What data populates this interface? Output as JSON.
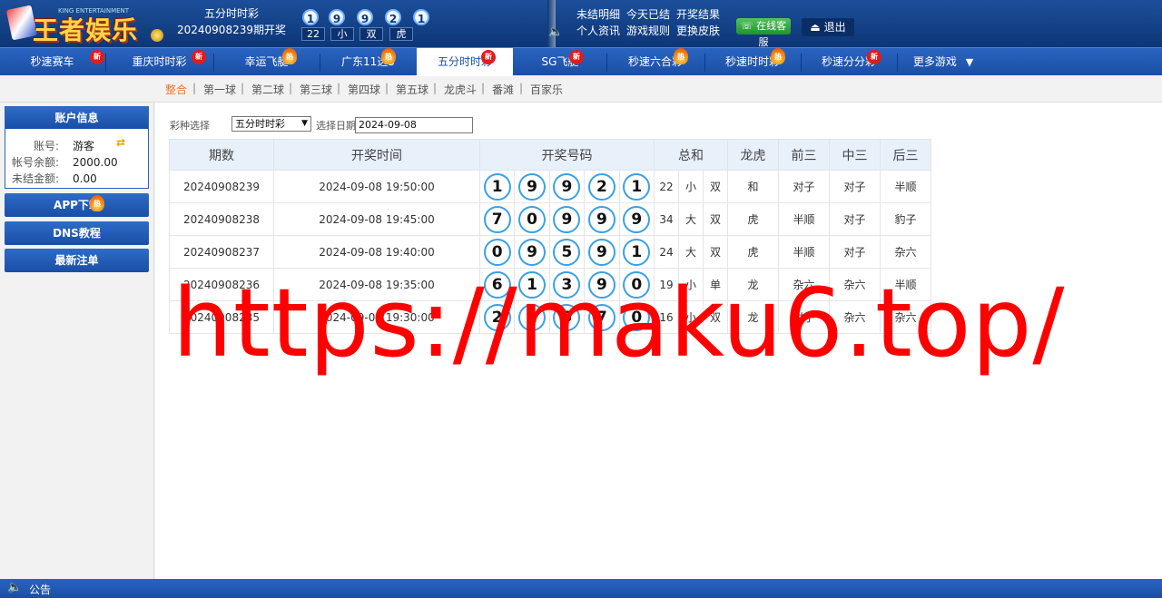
{
  "header": {
    "logo_text": "王者娱乐",
    "logo_sub": "KING ENTERTAINMENT",
    "current_game": "五分时时彩",
    "current_issue": "20240908239期开奖",
    "balls": [
      "1",
      "9",
      "9",
      "2",
      "1"
    ],
    "stats": [
      "22",
      "小",
      "双",
      "虎"
    ],
    "links_row1": [
      "未结明细",
      "今天已结",
      "开奖结果"
    ],
    "links_row2": [
      "个人资讯",
      "游戏规则",
      "更换皮肤"
    ],
    "service": "在线客服",
    "logout": "退出"
  },
  "nav": {
    "items": [
      {
        "label": "秒速赛车",
        "badge": "新"
      },
      {
        "label": "重庆时时彩",
        "badge": "新"
      },
      {
        "label": "幸运飞艇",
        "badge": "热"
      },
      {
        "label": "广东11选5",
        "badge": "热"
      },
      {
        "label": "五分时时彩",
        "badge": "新"
      },
      {
        "label": "SG飞艇",
        "badge": "新"
      },
      {
        "label": "秒速六合彩",
        "badge": "热"
      },
      {
        "label": "秒速时时彩",
        "badge": "热"
      },
      {
        "label": "秒速分分彩",
        "badge": "新"
      },
      {
        "label": "更多游戏",
        "badge": ""
      }
    ],
    "more_arrow": "▼"
  },
  "subnav": {
    "items": [
      "整合",
      "第一球",
      "第二球",
      "第三球",
      "第四球",
      "第五球",
      "龙虎斗",
      "番滩",
      "百家乐"
    ],
    "separator": "|"
  },
  "sidebar": {
    "account_title": "账户信息",
    "account_label": "账号:",
    "account_value": "游客",
    "balance_label": "帐号余额:",
    "balance_value": "2000.00",
    "unsettled_label": "未结金额:",
    "unsettled_value": "0.00",
    "app_download": "APP下载",
    "app_badge": "热",
    "dns_tutorial": "DNS教程",
    "latest_bets": "最新注单"
  },
  "filter": {
    "game_label": "彩种选择",
    "game_value": "五分时时彩",
    "date_label": "选择日期",
    "date_value": "2024-09-08"
  },
  "table": {
    "headers": {
      "issue": "期数",
      "time": "开奖时间",
      "numbers": "开奖号码",
      "sum": "总和",
      "dragon_tiger": "龙虎",
      "front3": "前三",
      "mid3": "中三",
      "back3": "后三"
    },
    "rows": [
      {
        "issue": "20240908239",
        "time": "2024-09-08 19:50:00",
        "balls": [
          "1",
          "9",
          "9",
          "2",
          "1"
        ],
        "sum": "22",
        "size": "小",
        "parity": "双",
        "dt": "和",
        "front": "对子",
        "mid": "对子",
        "back": "半顺"
      },
      {
        "issue": "20240908238",
        "time": "2024-09-08 19:45:00",
        "balls": [
          "7",
          "0",
          "9",
          "9",
          "9"
        ],
        "sum": "34",
        "size": "大",
        "parity": "双",
        "dt": "虎",
        "front": "半顺",
        "mid": "对子",
        "back": "豹子"
      },
      {
        "issue": "20240908237",
        "time": "2024-09-08 19:40:00",
        "balls": [
          "0",
          "9",
          "5",
          "9",
          "1"
        ],
        "sum": "24",
        "size": "大",
        "parity": "双",
        "dt": "虎",
        "front": "半顺",
        "mid": "对子",
        "back": "杂六"
      },
      {
        "issue": "20240908236",
        "time": "2024-09-08 19:35:00",
        "balls": [
          "6",
          "1",
          "3",
          "9",
          "0"
        ],
        "sum": "19",
        "size": "小",
        "parity": "单",
        "dt": "龙",
        "front": "杂六",
        "mid": "杂六",
        "back": "半顺"
      },
      {
        "issue": "20240908235",
        "time": "2024-09-08 19:30:00",
        "balls": [
          "2",
          "2",
          "5",
          "7",
          "0"
        ],
        "sum": "16",
        "size": "小",
        "parity": "双",
        "dt": "龙",
        "front": "对子",
        "mid": "杂六",
        "back": "杂六"
      }
    ]
  },
  "watermark": "https://maku6.top/",
  "footer": {
    "announcement": "公告"
  },
  "colors": {
    "primary": "#1a4ea5",
    "accent": "#f0742a",
    "red": "#e01a1a",
    "blue": "#1a3be0",
    "ball_border": "#3aa0e6"
  }
}
